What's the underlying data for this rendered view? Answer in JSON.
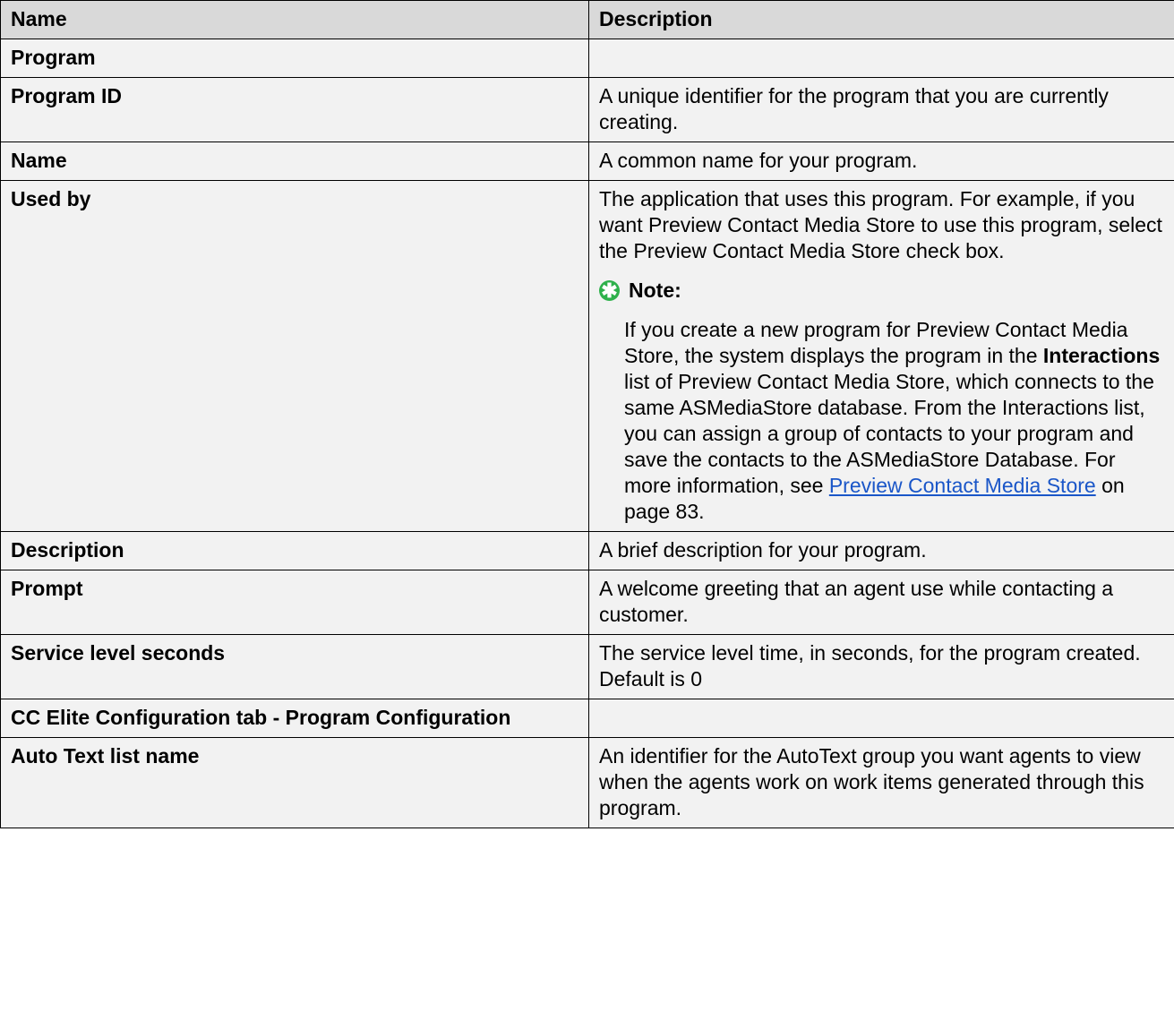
{
  "table": {
    "headers": [
      "Name",
      "Description"
    ],
    "rows": [
      {
        "name": "Program",
        "desc": ""
      },
      {
        "name": "Program ID",
        "desc": "A unique identifier for the program that you are currently creating."
      },
      {
        "name": "Name",
        "desc": "A common name for your program."
      },
      {
        "name": "Used by",
        "desc": "The application that uses this program. For example, if you want Preview Contact Media Store to use this program, select the Preview Contact Media Store check box."
      },
      {
        "name": "Description",
        "desc": "A brief description for your program."
      },
      {
        "name": "Prompt",
        "desc": "A welcome greeting that an agent use while contacting a customer."
      },
      {
        "name": "Service level seconds",
        "desc": "The service level time, in seconds, for the program created. Default is 0"
      },
      {
        "name": "CC Elite Configuration tab - Program Configuration",
        "desc": ""
      },
      {
        "name": "Auto Text list name",
        "desc": "An identifier for the AutoText group you want agents to view when the agents work on work items generated through this program."
      }
    ]
  },
  "note": {
    "icon": "star-note-icon",
    "icon_color": "#2eb14b",
    "title": "Note:",
    "text_1": "If you create a new program for Preview Contact Media Store, the system displays the program in the ",
    "bold": "Interactions",
    "text_2": " list of Preview Contact Media Store, which connects to the same ASMediaStore database. From the Interactions list, you can assign a group of contacts to your program and save the contacts to the ASMediaStore Database. For more information, see ",
    "link": "Preview Contact Media Store",
    "text_3": " on page 83."
  },
  "colors": {
    "header_bg": "#d9d9d9",
    "cell_bg": "#f2f2f2",
    "link": "#1a56c8"
  }
}
